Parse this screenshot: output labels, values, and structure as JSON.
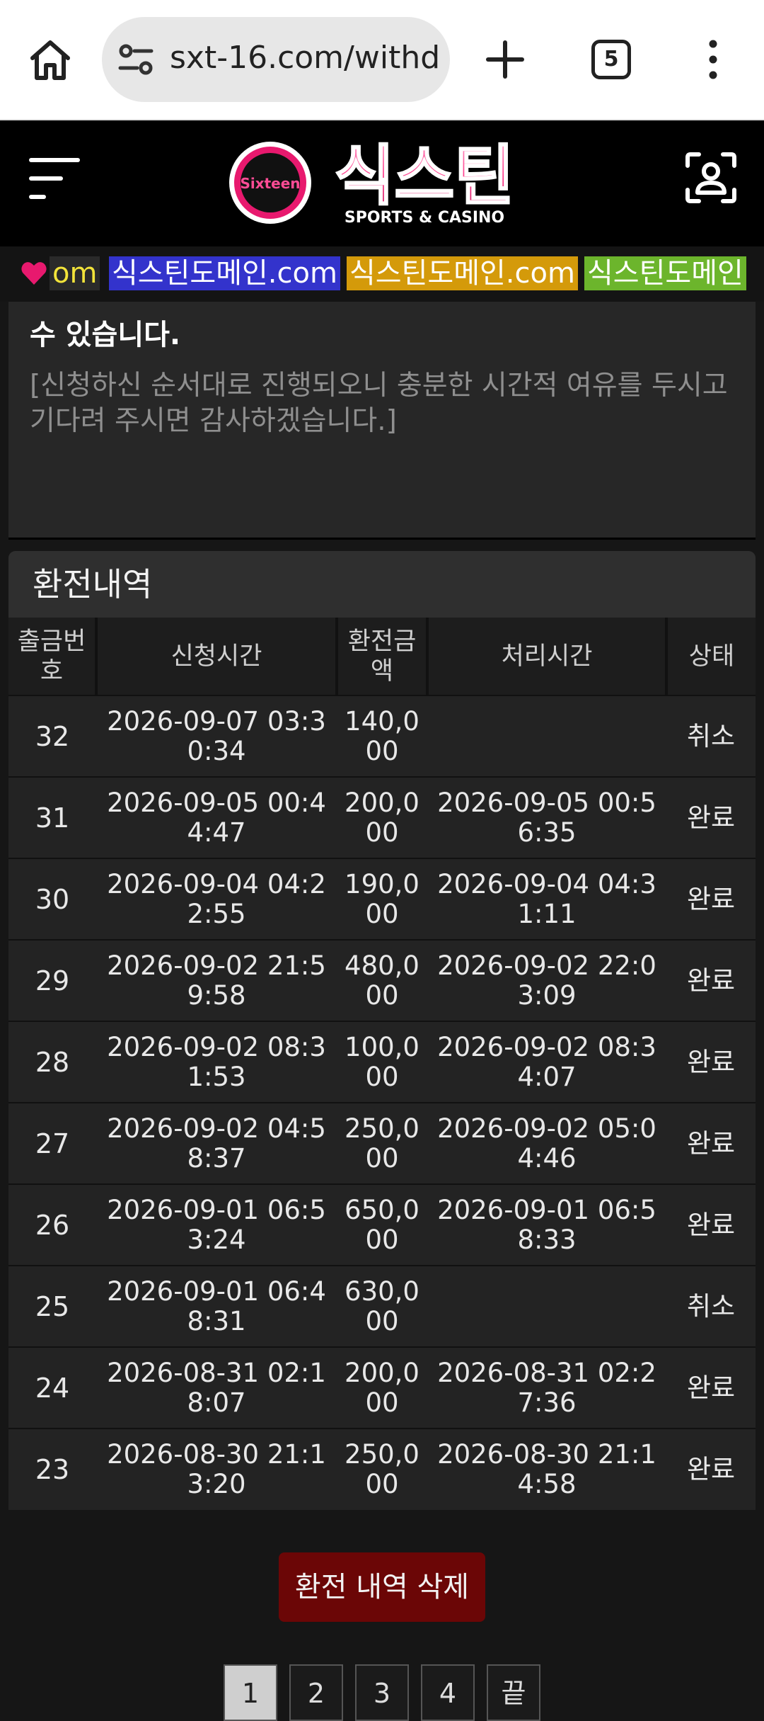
{
  "browser": {
    "url": "sxt-16.com/withd",
    "tab_count": "5"
  },
  "marquee": {
    "items": [
      "om",
      "식스틴도메인.com",
      "식스틴도메인.com",
      "식스틴도메인"
    ]
  },
  "notice": {
    "bold_text": "수 있습니다.",
    "gray_text": "[신청하신 순서대로 진행되오니 충분한 시간적 여유를 두시고 기다려 주시면 감사하겠습니다.]"
  },
  "history": {
    "title": "환전내역",
    "columns": [
      "출금번호",
      "신청시간",
      "환전금액",
      "처리시간",
      "상태"
    ],
    "rows": [
      {
        "no": "32",
        "req": "2026-09-07 03:30:34",
        "amt": "140,000",
        "proc": "",
        "status": "취소"
      },
      {
        "no": "31",
        "req": "2026-09-05 00:44:47",
        "amt": "200,000",
        "proc": "2026-09-05 00:56:35",
        "status": "완료"
      },
      {
        "no": "30",
        "req": "2026-09-04 04:22:55",
        "amt": "190,000",
        "proc": "2026-09-04 04:31:11",
        "status": "완료"
      },
      {
        "no": "29",
        "req": "2026-09-02 21:59:58",
        "amt": "480,000",
        "proc": "2026-09-02 22:03:09",
        "status": "완료"
      },
      {
        "no": "28",
        "req": "2026-09-02 08:31:53",
        "amt": "100,000",
        "proc": "2026-09-02 08:34:07",
        "status": "완료"
      },
      {
        "no": "27",
        "req": "2026-09-02 04:58:37",
        "amt": "250,000",
        "proc": "2026-09-02 05:04:46",
        "status": "완료"
      },
      {
        "no": "26",
        "req": "2026-09-01 06:53:24",
        "amt": "650,000",
        "proc": "2026-09-01 06:58:33",
        "status": "완료"
      },
      {
        "no": "25",
        "req": "2026-09-01 06:48:31",
        "amt": "630,000",
        "proc": "",
        "status": "취소"
      },
      {
        "no": "24",
        "req": "2026-08-31 02:18:07",
        "amt": "200,000",
        "proc": "2026-08-31 02:27:36",
        "status": "완료"
      },
      {
        "no": "23",
        "req": "2026-08-30 21:13:20",
        "amt": "250,000",
        "proc": "2026-08-30 21:14:58",
        "status": "완료"
      }
    ],
    "delete_label": "환전 내역 삭제"
  },
  "pagination": {
    "pages": [
      "1",
      "2",
      "3",
      "4",
      "끝"
    ],
    "active": "1"
  },
  "logo": {
    "badge_text": "Sixteen",
    "title": "식스틴",
    "subtitle": "SPORTS & CASINO"
  },
  "colors": {
    "accent": "#e8196e",
    "delete_button": "#6b0606"
  }
}
